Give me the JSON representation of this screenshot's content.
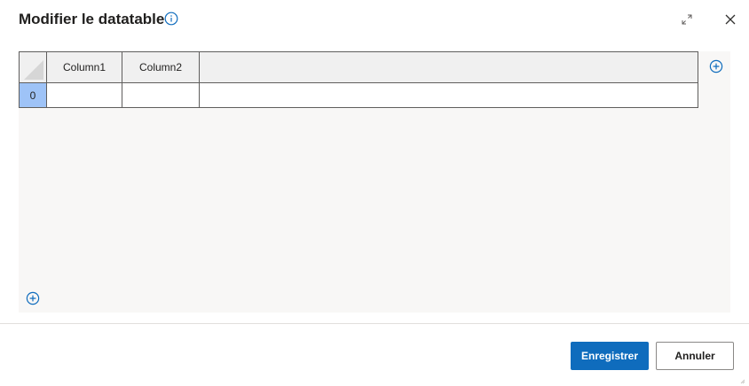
{
  "dialog": {
    "title": "Modifier le datatable",
    "icons": {
      "info": "info-icon",
      "expand": "expand-icon",
      "close": "close-icon",
      "add_column": "add-circle-icon",
      "add_row": "add-circle-icon"
    }
  },
  "table": {
    "columns": [
      "Column1",
      "Column2",
      ""
    ],
    "rows": [
      {
        "index": "0",
        "cells": [
          "",
          "",
          ""
        ]
      }
    ]
  },
  "footer": {
    "save_label": "Enregistrer",
    "cancel_label": "Annuler"
  },
  "colors": {
    "accent": "#0f6cbd",
    "selected_row_index": "#9ec3f7",
    "grid_background": "#f8f7f6",
    "header_background": "#f0f0f0"
  }
}
